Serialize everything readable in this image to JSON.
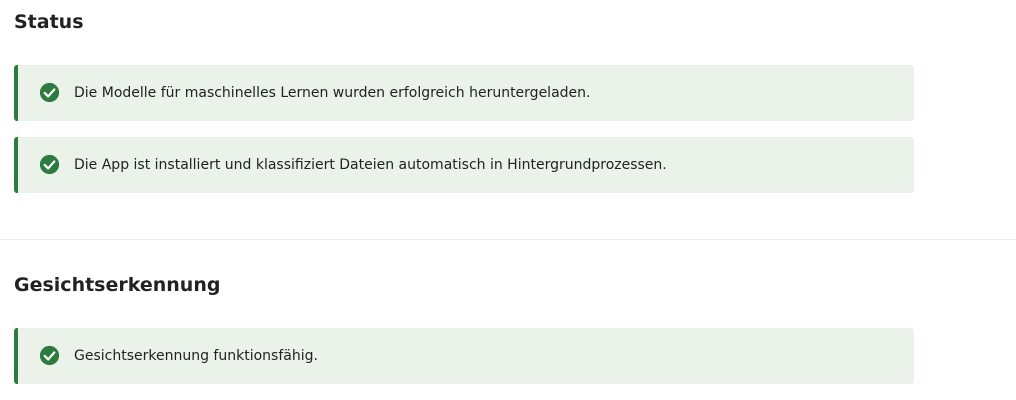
{
  "status": {
    "title": "Status",
    "messages": [
      {
        "text": "Die Modelle für maschinelles Lernen wurden erfolgreich heruntergeladen.",
        "icon": "check-circle-icon"
      },
      {
        "text": "Die App ist installiert und klassifiziert Dateien automatisch in Hintergrundprozessen.",
        "icon": "check-circle-icon"
      }
    ]
  },
  "face_recognition": {
    "title": "Gesichtserkennung",
    "messages": [
      {
        "text": "Gesichtserkennung funktionsfähig.",
        "icon": "check-circle-icon"
      }
    ]
  },
  "colors": {
    "success_accent": "#2d7b41",
    "success_background": "#eaf2ea",
    "divider": "#ededed",
    "text": "#222222"
  }
}
